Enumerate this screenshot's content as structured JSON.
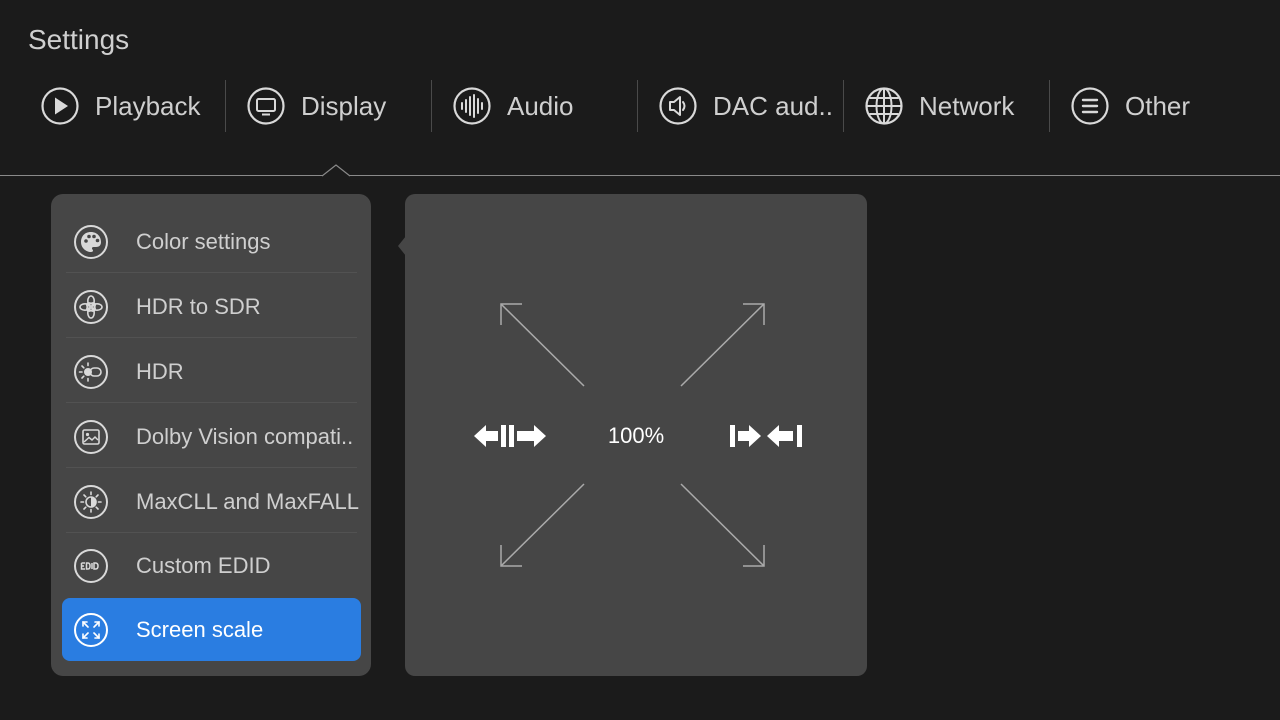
{
  "header": {
    "title": "Settings"
  },
  "tabs": [
    {
      "label": "Playback",
      "icon": "play-circle-icon"
    },
    {
      "label": "Display",
      "icon": "monitor-icon"
    },
    {
      "label": "Audio",
      "icon": "audio-wave-icon"
    },
    {
      "label": "DAC aud..",
      "icon": "speaker-icon"
    },
    {
      "label": "Network",
      "icon": "globe-icon"
    },
    {
      "label": "Other",
      "icon": "menu-lines-icon"
    }
  ],
  "display_menu": {
    "items": [
      {
        "label": "Color settings",
        "icon": "palette-icon"
      },
      {
        "label": "HDR to SDR",
        "icon": "flower-icon"
      },
      {
        "label": "HDR",
        "icon": "hdr-icon"
      },
      {
        "label": "Dolby Vision compati..",
        "icon": "image-icon"
      },
      {
        "label": "MaxCLL and MaxFALL",
        "icon": "brightness-icon"
      },
      {
        "label": "Custom EDID",
        "icon": "edid-icon"
      },
      {
        "label": "Screen scale",
        "icon": "expand-arrows-icon"
      }
    ],
    "selected_index": 6
  },
  "screen_scale": {
    "value": "100%"
  },
  "colors": {
    "accent": "#2a7de1",
    "background": "#1b1b1b",
    "panel": "#464646"
  }
}
